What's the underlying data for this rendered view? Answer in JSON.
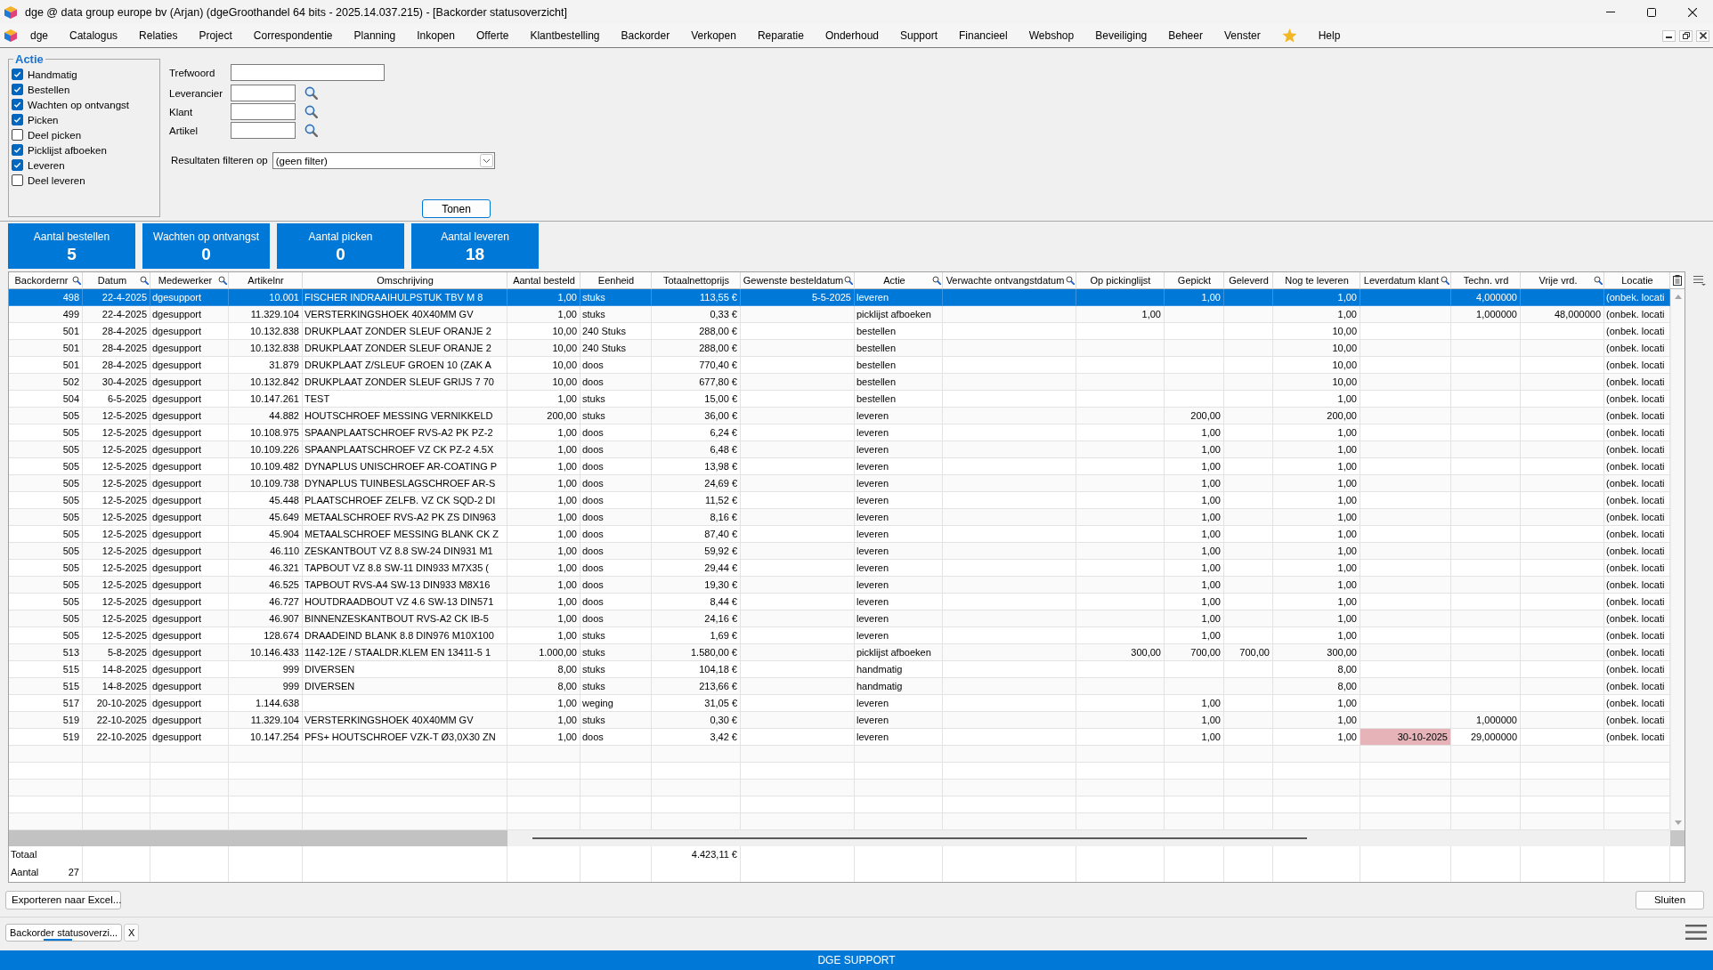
{
  "window": {
    "title": "dge @ data group europe bv (Arjan) (dgeGroothandel 64 bits - 2025.14.037.215) - [Backorder statusoverzicht]"
  },
  "menu": [
    {
      "kind": "menu",
      "label": "dge"
    },
    {
      "kind": "menu",
      "label": "Catalogus"
    },
    {
      "kind": "menu",
      "label": "Relaties"
    },
    {
      "kind": "menu",
      "label": "Project"
    },
    {
      "kind": "menu",
      "label": "Correspondentie"
    },
    {
      "kind": "menu",
      "label": "Planning"
    },
    {
      "kind": "menu",
      "label": "Inkopen"
    },
    {
      "kind": "menu",
      "label": "Offerte"
    },
    {
      "kind": "menu",
      "label": "Klantbestelling"
    },
    {
      "kind": "menu",
      "label": "Backorder"
    },
    {
      "kind": "menu",
      "label": "Verkopen"
    },
    {
      "kind": "menu",
      "label": "Reparatie"
    },
    {
      "kind": "menu",
      "label": "Onderhoud"
    },
    {
      "kind": "menu",
      "label": "Support"
    },
    {
      "kind": "menu",
      "label": "Financieel"
    },
    {
      "kind": "menu",
      "label": "Webshop"
    },
    {
      "kind": "menu",
      "label": "Beveiliging"
    },
    {
      "kind": "menu",
      "label": "Beheer"
    },
    {
      "kind": "menu",
      "label": "Venster"
    },
    {
      "kind": "favorites"
    },
    {
      "kind": "menu",
      "label": "Help"
    }
  ],
  "filters": {
    "group_title": "Actie",
    "checkboxes": [
      {
        "label": "Handmatig",
        "checked": true
      },
      {
        "label": "Bestellen",
        "checked": true
      },
      {
        "label": "Wachten op ontvangst",
        "checked": true
      },
      {
        "label": "Picken",
        "checked": true
      },
      {
        "label": "Deel picken",
        "checked": false
      },
      {
        "label": "Picklijst afboeken",
        "checked": true
      },
      {
        "label": "Leveren",
        "checked": true
      },
      {
        "label": "Deel leveren",
        "checked": false
      }
    ],
    "fields": [
      {
        "label": "Trefwoord",
        "kind": "text"
      },
      {
        "label": "Leverancier",
        "kind": "lookup"
      },
      {
        "label": "Klant",
        "kind": "lookup"
      },
      {
        "label": "Artikel",
        "kind": "lookup"
      }
    ],
    "result_filter": {
      "label": "Resultaten filteren op",
      "value": "(geen filter)"
    },
    "show_button": "Tonen"
  },
  "tiles": [
    {
      "label": "Aantal bestellen",
      "value": "5"
    },
    {
      "label": "Wachten op ontvangst",
      "value": "0"
    },
    {
      "label": "Aantal picken",
      "value": "0"
    },
    {
      "label": "Aantal leveren",
      "value": "18"
    }
  ],
  "table": {
    "columns": [
      {
        "label": "Backordernr",
        "filter": true
      },
      {
        "label": "Datum",
        "filter": true
      },
      {
        "label": "Medewerker",
        "filter": true
      },
      {
        "label": "Artikelnr",
        "filter": false
      },
      {
        "label": "Omschrijving",
        "filter": false
      },
      {
        "label": "Aantal besteld",
        "filter": false
      },
      {
        "label": "Eenheid",
        "filter": false
      },
      {
        "label": "Totaalnettoprijs",
        "filter": false
      },
      {
        "label": "Gewenste besteldatum",
        "filter": true
      },
      {
        "label": "Actie",
        "filter": true
      },
      {
        "label": "Verwachte ontvangstdatum",
        "filter": true
      },
      {
        "label": "Op pickinglijst",
        "filter": false
      },
      {
        "label": "Gepickt",
        "filter": false
      },
      {
        "label": "Geleverd",
        "filter": false
      },
      {
        "label": "Nog te leveren",
        "filter": false
      },
      {
        "label": "Leverdatum klant",
        "filter": true
      },
      {
        "label": "Techn. vrd",
        "filter": false
      },
      {
        "label": "Vrije vrd.",
        "filter": true
      },
      {
        "label": "Locatie",
        "filter": false
      }
    ],
    "rows": [
      {
        "backordernr": "498",
        "datum": "22-4-2025",
        "medewerker": "dgesupport",
        "artikelnr": "10.001",
        "omschrijving": "FISCHER INDRAAIHULPSTUK TBV M 8",
        "aantal_besteld": "1,00",
        "eenheid": "stuks",
        "totaalnettoprijs": "113,55 €",
        "gewenste_besteldatum": "5-5-2025",
        "actie": "leveren",
        "gepickt": "1,00",
        "nog_te_leveren": "1,00",
        "techn_vrd": "4,000000",
        "locatie": "(onbek. locati",
        "selected": true,
        "flagged": false
      },
      {
        "backordernr": "499",
        "datum": "22-4-2025",
        "medewerker": "dgesupport",
        "artikelnr": "11.329.104",
        "omschrijving": "VERSTERKINGSHOEK 40X40MM GV",
        "aantal_besteld": "1,00",
        "eenheid": "stuks",
        "totaalnettoprijs": "0,33 €",
        "actie": "picklijst afboeken",
        "op_pickinglijst": "1,00",
        "nog_te_leveren": "1,00",
        "techn_vrd": "1,000000",
        "vrije_vrd": "48,000000",
        "locatie": "(onbek. locati",
        "selected": false,
        "flagged": false
      },
      {
        "backordernr": "501",
        "datum": "28-4-2025",
        "medewerker": "dgesupport",
        "artikelnr": "10.132.838",
        "omschrijving": "DRUKPLAAT ZONDER SLEUF ORANJE 2",
        "aantal_besteld": "10,00",
        "eenheid": "240 Stuks",
        "totaalnettoprijs": "288,00 €",
        "actie": "bestellen",
        "nog_te_leveren": "10,00",
        "locatie": "(onbek. locati",
        "selected": false,
        "flagged": false
      },
      {
        "backordernr": "501",
        "datum": "28-4-2025",
        "medewerker": "dgesupport",
        "artikelnr": "10.132.838",
        "omschrijving": "DRUKPLAAT ZONDER SLEUF ORANJE 2",
        "aantal_besteld": "10,00",
        "eenheid": "240 Stuks",
        "totaalnettoprijs": "288,00 €",
        "actie": "bestellen",
        "nog_te_leveren": "10,00",
        "locatie": "(onbek. locati",
        "selected": false,
        "flagged": false
      },
      {
        "backordernr": "501",
        "datum": "28-4-2025",
        "medewerker": "dgesupport",
        "artikelnr": "31.879",
        "omschrijving": "DRUKPLAAT Z/SLEUF GROEN 10 (ZAK A",
        "aantal_besteld": "10,00",
        "eenheid": "doos",
        "totaalnettoprijs": "770,40 €",
        "actie": "bestellen",
        "nog_te_leveren": "10,00",
        "locatie": "(onbek. locati",
        "selected": false,
        "flagged": false
      },
      {
        "backordernr": "502",
        "datum": "30-4-2025",
        "medewerker": "dgesupport",
        "artikelnr": "10.132.842",
        "omschrijving": "DRUKPLAAT ZONDER SLEUF GRIJS 7 70",
        "aantal_besteld": "10,00",
        "eenheid": "doos",
        "totaalnettoprijs": "677,80 €",
        "actie": "bestellen",
        "nog_te_leveren": "10,00",
        "locatie": "(onbek. locati",
        "selected": false,
        "flagged": false
      },
      {
        "backordernr": "504",
        "datum": "6-5-2025",
        "medewerker": "dgesupport",
        "artikelnr": "10.147.261",
        "omschrijving": "TEST",
        "aantal_besteld": "1,00",
        "eenheid": "stuks",
        "totaalnettoprijs": "15,00 €",
        "actie": "bestellen",
        "nog_te_leveren": "1,00",
        "locatie": "(onbek. locati",
        "selected": false,
        "flagged": false
      },
      {
        "backordernr": "505",
        "datum": "12-5-2025",
        "medewerker": "dgesupport",
        "artikelnr": "44.882",
        "omschrijving": "HOUTSCHROEF MESSING VERNIKKELD",
        "aantal_besteld": "200,00",
        "eenheid": "stuks",
        "totaalnettoprijs": "36,00 €",
        "actie": "leveren",
        "gepickt": "200,00",
        "nog_te_leveren": "200,00",
        "locatie": "(onbek. locati",
        "selected": false,
        "flagged": false
      },
      {
        "backordernr": "505",
        "datum": "12-5-2025",
        "medewerker": "dgesupport",
        "artikelnr": "10.108.975",
        "omschrijving": "SPAANPLAATSCHROEF RVS-A2 PK PZ-2",
        "aantal_besteld": "1,00",
        "eenheid": "doos",
        "totaalnettoprijs": "6,24 €",
        "actie": "leveren",
        "gepickt": "1,00",
        "nog_te_leveren": "1,00",
        "locatie": "(onbek. locati",
        "selected": false,
        "flagged": false
      },
      {
        "backordernr": "505",
        "datum": "12-5-2025",
        "medewerker": "dgesupport",
        "artikelnr": "10.109.226",
        "omschrijving": "SPAANPLAATSCHROEF VZ CK PZ-2 4.5X",
        "aantal_besteld": "1,00",
        "eenheid": "doos",
        "totaalnettoprijs": "6,48 €",
        "actie": "leveren",
        "gepickt": "1,00",
        "nog_te_leveren": "1,00",
        "locatie": "(onbek. locati",
        "selected": false,
        "flagged": false
      },
      {
        "backordernr": "505",
        "datum": "12-5-2025",
        "medewerker": "dgesupport",
        "artikelnr": "10.109.482",
        "omschrijving": "DYNAPLUS UNISCHROEF AR-COATING P",
        "aantal_besteld": "1,00",
        "eenheid": "doos",
        "totaalnettoprijs": "13,98 €",
        "actie": "leveren",
        "gepickt": "1,00",
        "nog_te_leveren": "1,00",
        "locatie": "(onbek. locati",
        "selected": false,
        "flagged": false
      },
      {
        "backordernr": "505",
        "datum": "12-5-2025",
        "medewerker": "dgesupport",
        "artikelnr": "10.109.738",
        "omschrijving": "DYNAPLUS TUINBESLAGSCHROEF AR-S",
        "aantal_besteld": "1,00",
        "eenheid": "doos",
        "totaalnettoprijs": "24,69 €",
        "actie": "leveren",
        "gepickt": "1,00",
        "nog_te_leveren": "1,00",
        "locatie": "(onbek. locati",
        "selected": false,
        "flagged": false
      },
      {
        "backordernr": "505",
        "datum": "12-5-2025",
        "medewerker": "dgesupport",
        "artikelnr": "45.448",
        "omschrijving": "PLAATSCHROEF ZELFB. VZ CK SQD-2 DI",
        "aantal_besteld": "1,00",
        "eenheid": "doos",
        "totaalnettoprijs": "11,52 €",
        "actie": "leveren",
        "gepickt": "1,00",
        "nog_te_leveren": "1,00",
        "locatie": "(onbek. locati",
        "selected": false,
        "flagged": false
      },
      {
        "backordernr": "505",
        "datum": "12-5-2025",
        "medewerker": "dgesupport",
        "artikelnr": "45.649",
        "omschrijving": "METAALSCHROEF RVS-A2 PK ZS DIN963",
        "aantal_besteld": "1,00",
        "eenheid": "doos",
        "totaalnettoprijs": "8,16 €",
        "actie": "leveren",
        "gepickt": "1,00",
        "nog_te_leveren": "1,00",
        "locatie": "(onbek. locati",
        "selected": false,
        "flagged": false
      },
      {
        "backordernr": "505",
        "datum": "12-5-2025",
        "medewerker": "dgesupport",
        "artikelnr": "45.904",
        "omschrijving": "METAALSCHROEF MESSING BLANK CK Z",
        "aantal_besteld": "1,00",
        "eenheid": "doos",
        "totaalnettoprijs": "87,40 €",
        "actie": "leveren",
        "gepickt": "1,00",
        "nog_te_leveren": "1,00",
        "locatie": "(onbek. locati",
        "selected": false,
        "flagged": false
      },
      {
        "backordernr": "505",
        "datum": "12-5-2025",
        "medewerker": "dgesupport",
        "artikelnr": "46.110",
        "omschrijving": "ZESKANTBOUT VZ 8.8 SW-24 DIN931 M1",
        "aantal_besteld": "1,00",
        "eenheid": "doos",
        "totaalnettoprijs": "59,92 €",
        "actie": "leveren",
        "gepickt": "1,00",
        "nog_te_leveren": "1,00",
        "locatie": "(onbek. locati",
        "selected": false,
        "flagged": false
      },
      {
        "backordernr": "505",
        "datum": "12-5-2025",
        "medewerker": "dgesupport",
        "artikelnr": "46.321",
        "omschrijving": "TAPBOUT VZ 8.8 SW-11 DIN933 M7X35 (",
        "aantal_besteld": "1,00",
        "eenheid": "doos",
        "totaalnettoprijs": "29,44 €",
        "actie": "leveren",
        "gepickt": "1,00",
        "nog_te_leveren": "1,00",
        "locatie": "(onbek. locati",
        "selected": false,
        "flagged": false
      },
      {
        "backordernr": "505",
        "datum": "12-5-2025",
        "medewerker": "dgesupport",
        "artikelnr": "46.525",
        "omschrijving": "TAPBOUT RVS-A4 SW-13 DIN933 M8X16",
        "aantal_besteld": "1,00",
        "eenheid": "doos",
        "totaalnettoprijs": "19,30 €",
        "actie": "leveren",
        "gepickt": "1,00",
        "nog_te_leveren": "1,00",
        "locatie": "(onbek. locati",
        "selected": false,
        "flagged": false
      },
      {
        "backordernr": "505",
        "datum": "12-5-2025",
        "medewerker": "dgesupport",
        "artikelnr": "46.727",
        "omschrijving": "HOUTDRAADBOUT VZ 4.6 SW-13 DIN571",
        "aantal_besteld": "1,00",
        "eenheid": "doos",
        "totaalnettoprijs": "8,44 €",
        "actie": "leveren",
        "gepickt": "1,00",
        "nog_te_leveren": "1,00",
        "locatie": "(onbek. locati",
        "selected": false,
        "flagged": false
      },
      {
        "backordernr": "505",
        "datum": "12-5-2025",
        "medewerker": "dgesupport",
        "artikelnr": "46.907",
        "omschrijving": "BINNENZESKANTBOUT RVS-A2 CK IB-5",
        "aantal_besteld": "1,00",
        "eenheid": "doos",
        "totaalnettoprijs": "24,16 €",
        "actie": "leveren",
        "gepickt": "1,00",
        "nog_te_leveren": "1,00",
        "locatie": "(onbek. locati",
        "selected": false,
        "flagged": false
      },
      {
        "backordernr": "505",
        "datum": "12-5-2025",
        "medewerker": "dgesupport",
        "artikelnr": "128.674",
        "omschrijving": "DRAADEIND BLANK 8.8 DIN976 M10X100",
        "aantal_besteld": "1,00",
        "eenheid": "stuks",
        "totaalnettoprijs": "1,69 €",
        "actie": "leveren",
        "gepickt": "1,00",
        "nog_te_leveren": "1,00",
        "locatie": "(onbek. locati",
        "selected": false,
        "flagged": false
      },
      {
        "backordernr": "513",
        "datum": "5-8-2025",
        "medewerker": "dgesupport",
        "artikelnr": "10.146.433",
        "omschrijving": "1142-12E / STAALDR.KLEM EN 13411-5 1",
        "aantal_besteld": "1.000,00",
        "eenheid": "stuks",
        "totaalnettoprijs": "1.580,00 €",
        "actie": "picklijst afboeken",
        "op_pickinglijst": "300,00",
        "gepickt": "700,00",
        "geleverd": "700,00",
        "nog_te_leveren": "300,00",
        "locatie": "(onbek. locati",
        "selected": false,
        "flagged": false
      },
      {
        "backordernr": "515",
        "datum": "14-8-2025",
        "medewerker": "dgesupport",
        "artikelnr": "999",
        "omschrijving": "DIVERSEN",
        "aantal_besteld": "8,00",
        "eenheid": "stuks",
        "totaalnettoprijs": "104,18 €",
        "actie": "handmatig",
        "nog_te_leveren": "8,00",
        "locatie": "(onbek. locati",
        "selected": false,
        "flagged": false
      },
      {
        "backordernr": "515",
        "datum": "14-8-2025",
        "medewerker": "dgesupport",
        "artikelnr": "999",
        "omschrijving": "DIVERSEN",
        "aantal_besteld": "8,00",
        "eenheid": "stuks",
        "totaalnettoprijs": "213,66 €",
        "actie": "handmatig",
        "nog_te_leveren": "8,00",
        "locatie": "(onbek. locati",
        "selected": false,
        "flagged": false
      },
      {
        "backordernr": "517",
        "datum": "20-10-2025",
        "medewerker": "dgesupport",
        "artikelnr": "1.144.638",
        "aantal_besteld": "1,00",
        "eenheid": "weging",
        "totaalnettoprijs": "31,05 €",
        "actie": "leveren",
        "gepickt": "1,00",
        "nog_te_leveren": "1,00",
        "locatie": "(onbek. locati",
        "selected": false,
        "flagged": false
      },
      {
        "backordernr": "519",
        "datum": "22-10-2025",
        "medewerker": "dgesupport",
        "artikelnr": "11.329.104",
        "omschrijving": "VERSTERKINGSHOEK 40X40MM GV",
        "aantal_besteld": "1,00",
        "eenheid": "stuks",
        "totaalnettoprijs": "0,30 €",
        "actie": "leveren",
        "gepickt": "1,00",
        "nog_te_leveren": "1,00",
        "techn_vrd": "1,000000",
        "locatie": "(onbek. locati",
        "selected": false,
        "flagged": false
      },
      {
        "backordernr": "519",
        "datum": "22-10-2025",
        "medewerker": "dgesupport",
        "artikelnr": "10.147.254",
        "omschrijving": "PFS+ HOUTSCHROEF VZK-T Ø3,0X30 ZN",
        "aantal_besteld": "1,00",
        "eenheid": "doos",
        "totaalnettoprijs": "3,42 €",
        "actie": "leveren",
        "gepickt": "1,00",
        "nog_te_leveren": "1,00",
        "leverdatum_klant": "30-10-2025",
        "techn_vrd": "29,000000",
        "locatie": "(onbek. locati",
        "selected": false,
        "flagged": true
      }
    ],
    "totals": {
      "label": "Totaal",
      "price_total": "4.423,11 €",
      "count_label": "Aantal",
      "count": "27"
    }
  },
  "footer": {
    "export_button": "Exporteren naar Excel...",
    "close_button": "Sluiten"
  },
  "tabs": [
    {
      "label": "Backorder statusoverzi...",
      "close": "X",
      "selected": true
    }
  ],
  "status_bar": {
    "text": "DGE SUPPORT"
  }
}
